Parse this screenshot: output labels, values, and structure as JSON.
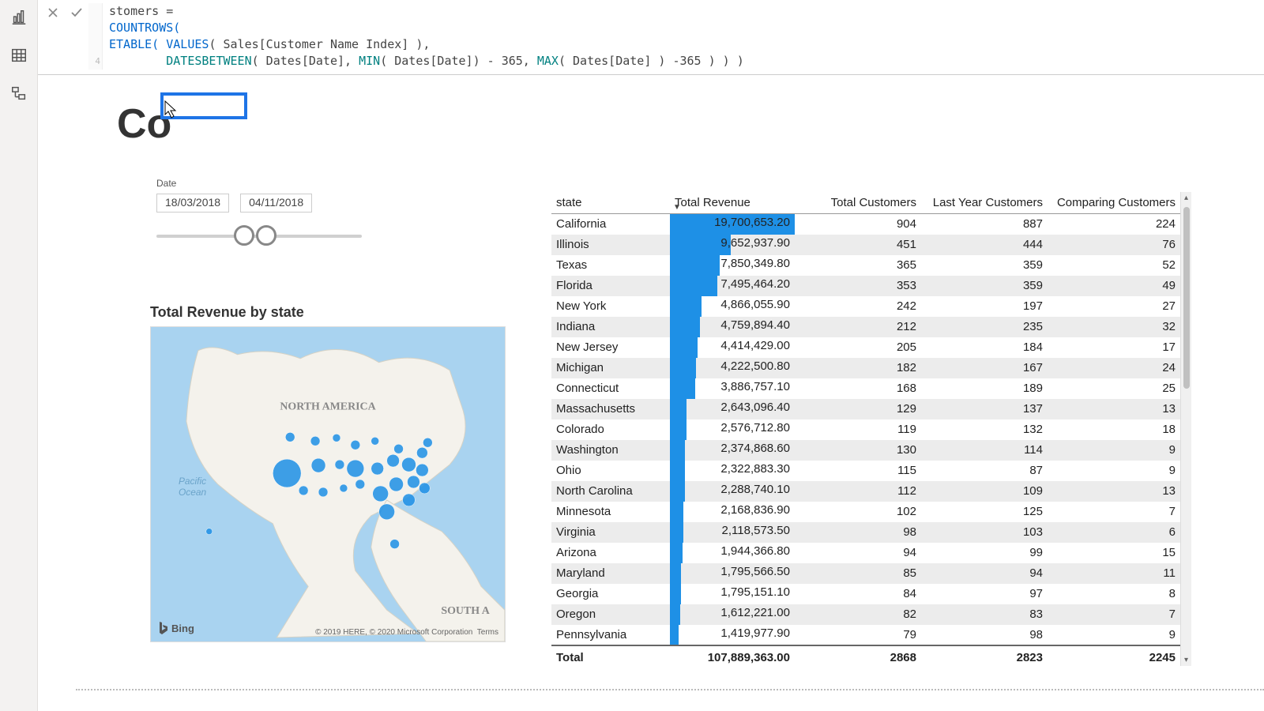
{
  "rail": {
    "report_icon": "report",
    "table_icon": "table",
    "model_icon": "model"
  },
  "formula": {
    "line1_fragment": "stomers =",
    "line2_countrows": "COUNTROWS(",
    "line3_prefix_fn": "ETABLE( ",
    "line3_values": "VALUES",
    "line3_after_values": "( Sales[Customer Name Index] ),",
    "line4_num": "4",
    "line4_dbw": "DATESBETWEEN",
    "line4_mid1": "( Dates[Date], ",
    "line4_min": "MIN",
    "line4_mid2": "( Dates[Date]) - 365, ",
    "line4_max": "MAX",
    "line4_tail": "( Dates[Date] ) -365 ) ) )"
  },
  "canvas": {
    "bg_title": "Co"
  },
  "date_slicer": {
    "label": "Date",
    "from": "18/03/2018",
    "to": "04/11/2018"
  },
  "map": {
    "title": "Total Revenue by state",
    "na_label": "NORTH AMERICA",
    "sa_label": "SOUTH A",
    "pacific_label": "Pacific\nOcean",
    "bing": "Bing",
    "attr": "© 2019 HERE, © 2020 Microsoft Corporation",
    "terms": "Terms"
  },
  "table": {
    "headers": {
      "state": "state",
      "revenue": "Total Revenue",
      "customers": "Total Customers",
      "last_year": "Last Year Customers",
      "comparing": "Comparing Customers"
    },
    "rows": [
      {
        "state": "California",
        "rev": "19,700,653.20",
        "bar": 100,
        "cust": "904",
        "ly": "887",
        "cmp": "224"
      },
      {
        "state": "Illinois",
        "rev": "9,652,937.90",
        "bar": 49,
        "cust": "451",
        "ly": "444",
        "cmp": "76"
      },
      {
        "state": "Texas",
        "rev": "7,850,349.80",
        "bar": 40,
        "cust": "365",
        "ly": "359",
        "cmp": "52"
      },
      {
        "state": "Florida",
        "rev": "7,495,464.20",
        "bar": 38,
        "cust": "353",
        "ly": "359",
        "cmp": "49"
      },
      {
        "state": "New York",
        "rev": "4,866,055.90",
        "bar": 25,
        "cust": "242",
        "ly": "197",
        "cmp": "27"
      },
      {
        "state": "Indiana",
        "rev": "4,759,894.40",
        "bar": 24,
        "cust": "212",
        "ly": "235",
        "cmp": "32"
      },
      {
        "state": "New Jersey",
        "rev": "4,414,429.00",
        "bar": 22,
        "cust": "205",
        "ly": "184",
        "cmp": "17"
      },
      {
        "state": "Michigan",
        "rev": "4,222,500.80",
        "bar": 21,
        "cust": "182",
        "ly": "167",
        "cmp": "24"
      },
      {
        "state": "Connecticut",
        "rev": "3,886,757.10",
        "bar": 20,
        "cust": "168",
        "ly": "189",
        "cmp": "25"
      },
      {
        "state": "Massachusetts",
        "rev": "2,643,096.40",
        "bar": 13,
        "cust": "129",
        "ly": "137",
        "cmp": "13"
      },
      {
        "state": "Colorado",
        "rev": "2,576,712.80",
        "bar": 13,
        "cust": "119",
        "ly": "132",
        "cmp": "18"
      },
      {
        "state": "Washington",
        "rev": "2,374,868.60",
        "bar": 12,
        "cust": "130",
        "ly": "114",
        "cmp": "9"
      },
      {
        "state": "Ohio",
        "rev": "2,322,883.30",
        "bar": 12,
        "cust": "115",
        "ly": "87",
        "cmp": "9"
      },
      {
        "state": "North Carolina",
        "rev": "2,288,740.10",
        "bar": 12,
        "cust": "112",
        "ly": "109",
        "cmp": "13"
      },
      {
        "state": "Minnesota",
        "rev": "2,168,836.90",
        "bar": 11,
        "cust": "102",
        "ly": "125",
        "cmp": "7"
      },
      {
        "state": "Virginia",
        "rev": "2,118,573.50",
        "bar": 11,
        "cust": "98",
        "ly": "103",
        "cmp": "6"
      },
      {
        "state": "Arizona",
        "rev": "1,944,366.80",
        "bar": 10,
        "cust": "94",
        "ly": "99",
        "cmp": "15"
      },
      {
        "state": "Maryland",
        "rev": "1,795,566.50",
        "bar": 9,
        "cust": "85",
        "ly": "94",
        "cmp": "11"
      },
      {
        "state": "Georgia",
        "rev": "1,795,151.10",
        "bar": 9,
        "cust": "84",
        "ly": "97",
        "cmp": "8"
      },
      {
        "state": "Oregon",
        "rev": "1,612,221.00",
        "bar": 8,
        "cust": "82",
        "ly": "83",
        "cmp": "7"
      },
      {
        "state": "Pennsylvania",
        "rev": "1,419,977.90",
        "bar": 7,
        "cust": "79",
        "ly": "98",
        "cmp": "9"
      }
    ],
    "total": {
      "label": "Total",
      "rev": "107,889,363.00",
      "cust": "2868",
      "ly": "2823",
      "cmp": "2245"
    }
  }
}
